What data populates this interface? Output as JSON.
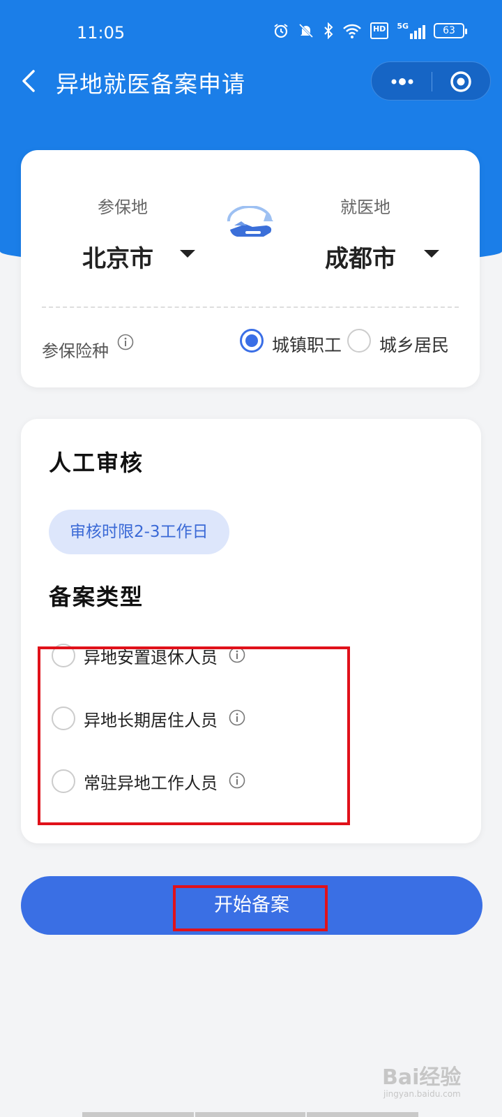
{
  "status_bar": {
    "time": "11:05",
    "icons": [
      "alarm-icon",
      "mute-icon",
      "bluetooth-icon",
      "wifi-icon",
      "hd-icon",
      "signal-5g-icon",
      "battery-icon"
    ],
    "hd": "HD",
    "net": "5G",
    "battery": "63"
  },
  "nav": {
    "title": "异地就医备案申请"
  },
  "location_card": {
    "insured_label": "参保地",
    "insured_value": "北京市",
    "medical_label": "就医地",
    "medical_value": "成都市",
    "insurance_type_label": "参保险种",
    "options": [
      {
        "label": "城镇职工",
        "selected": true
      },
      {
        "label": "城乡居民",
        "selected": false
      }
    ]
  },
  "review_card": {
    "review_title": "人工审核",
    "review_pill": "审核时限2-3工作日",
    "type_title": "备案类型",
    "types": [
      {
        "label": "异地安置退休人员"
      },
      {
        "label": "异地长期居住人员"
      },
      {
        "label": "常驻异地工作人员"
      }
    ]
  },
  "start_button": "开始备案",
  "watermark": {
    "text": "Bai经验",
    "sub": "jingyan.baidu.com"
  },
  "colors": {
    "primary_blue": "#1b7ee8",
    "button_blue": "#3a6fe4",
    "highlight_red": "#e0111a"
  }
}
